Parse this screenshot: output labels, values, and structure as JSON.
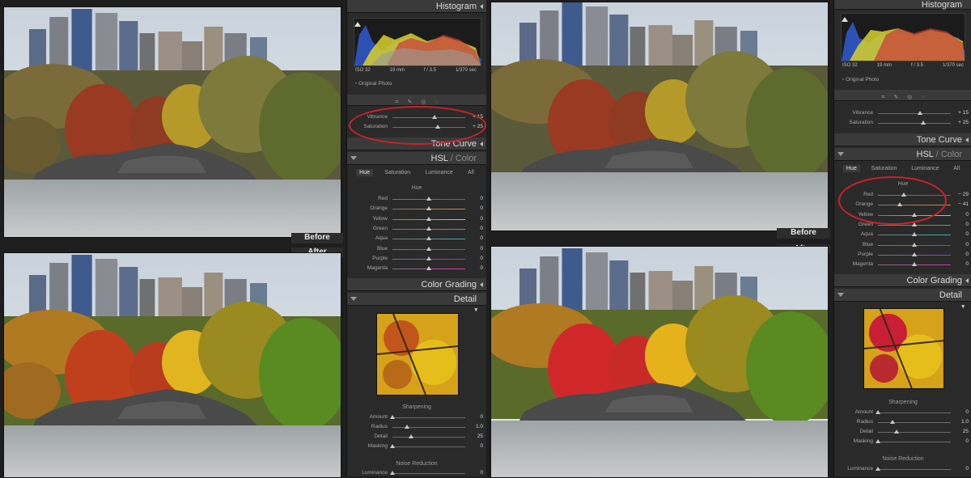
{
  "labels": {
    "before": "Before",
    "after": "After"
  },
  "panels": {
    "histogram": "Histogram",
    "iso": "ISO 32",
    "focal": "19 mm",
    "aperture": "f / 3.5",
    "shutter": "1/370 sec",
    "original_photo": "Original Photo",
    "tone_curve": "Tone Curve",
    "hsl": "HSL",
    "hsl_sep": " / ",
    "color": "Color",
    "color_grading": "Color Grading",
    "detail": "Detail",
    "sharpening": "Sharpening",
    "noise_reduction": "Noise Reduction",
    "tabs": [
      "Hue",
      "Saturation",
      "Luminance",
      "All"
    ],
    "hue_title": "Hue"
  },
  "left_panel": {
    "presence": [
      {
        "label": "Vibrance",
        "value": "+ 15",
        "level": 0.575
      },
      {
        "label": "Saturation",
        "value": "+ 25",
        "level": 0.625
      }
    ],
    "hue": [
      {
        "label": "Red",
        "value": "0",
        "level": 0.5,
        "color": "#c83a3a"
      },
      {
        "label": "Orange",
        "value": "0",
        "level": 0.5,
        "color": "#d8883a"
      },
      {
        "label": "Yellow",
        "value": "0",
        "level": 0.5,
        "color": "#d6c83a"
      },
      {
        "label": "Green",
        "value": "0",
        "level": 0.5,
        "color": "#4cb04c"
      },
      {
        "label": "Aqua",
        "value": "0",
        "level": 0.5,
        "color": "#3ab4b4"
      },
      {
        "label": "Blue",
        "value": "0",
        "level": 0.5,
        "color": "#3a5ed8"
      },
      {
        "label": "Purple",
        "value": "0",
        "level": 0.5,
        "color": "#8a3ad8"
      },
      {
        "label": "Magenta",
        "value": "0",
        "level": 0.5,
        "color": "#d83ab0"
      }
    ],
    "sharpening": [
      {
        "label": "Amount",
        "value": "0",
        "level": 0.0
      },
      {
        "label": "Radius",
        "value": "1.0",
        "level": 0.2
      },
      {
        "label": "Detail",
        "value": "25",
        "level": 0.25
      },
      {
        "label": "Masking",
        "value": "0",
        "level": 0.0
      }
    ],
    "noise": [
      {
        "label": "Luminance",
        "value": "0",
        "level": 0.0
      }
    ]
  },
  "right_panel": {
    "presence": [
      {
        "label": "Vibrance",
        "value": "+ 15",
        "level": 0.575
      },
      {
        "label": "Saturation",
        "value": "+ 25",
        "level": 0.625
      }
    ],
    "hue": [
      {
        "label": "Red",
        "value": "− 29",
        "level": 0.355,
        "color": "#c83a3a"
      },
      {
        "label": "Orange",
        "value": "− 41",
        "level": 0.295,
        "color": "#d8883a"
      },
      {
        "label": "Yellow",
        "value": "0",
        "level": 0.5,
        "color": "#d6c83a"
      },
      {
        "label": "Green",
        "value": "0",
        "level": 0.5,
        "color": "#4cb04c"
      },
      {
        "label": "Aqua",
        "value": "0",
        "level": 0.5,
        "color": "#3ab4b4"
      },
      {
        "label": "Blue",
        "value": "0",
        "level": 0.5,
        "color": "#3a5ed8"
      },
      {
        "label": "Purple",
        "value": "0",
        "level": 0.5,
        "color": "#8a3ad8"
      },
      {
        "label": "Magenta",
        "value": "0",
        "level": 0.5,
        "color": "#d83ab0"
      }
    ],
    "sharpening": [
      {
        "label": "Amount",
        "value": "0",
        "level": 0.0
      },
      {
        "label": "Radius",
        "value": "1.0",
        "level": 0.2
      },
      {
        "label": "Detail",
        "value": "25",
        "level": 0.25
      },
      {
        "label": "Masking",
        "value": "0",
        "level": 0.0
      }
    ],
    "noise": [
      {
        "label": "Luminance",
        "value": "0",
        "level": 0.0
      }
    ]
  },
  "colors": {
    "highlight_ring": "#d0202a",
    "panel_bg": "#2a2a2a",
    "header_bg": "#3a3a3a"
  }
}
